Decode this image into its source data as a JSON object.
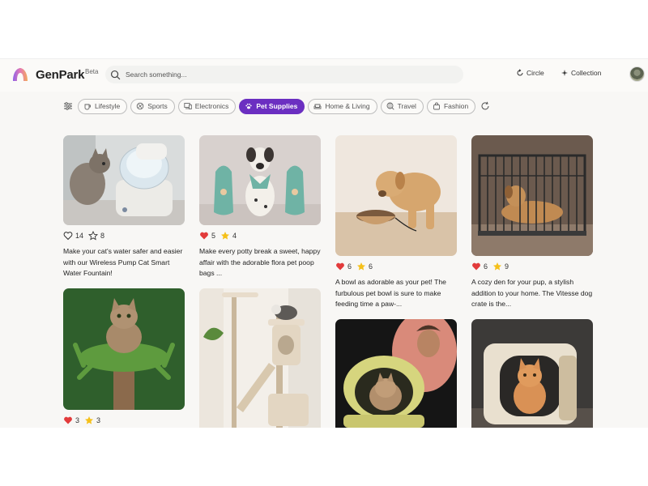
{
  "header": {
    "brand": "GenPark",
    "beta": "Beta",
    "search_placeholder": "Search something...",
    "nav": [
      {
        "label": "Circle",
        "icon": "circle-refresh-icon"
      },
      {
        "label": "Collection",
        "icon": "sparkle-icon"
      }
    ],
    "accent": "#6b2fc1"
  },
  "categories": [
    {
      "label": "Lifestyle",
      "icon": "cup-icon",
      "active": false
    },
    {
      "label": "Sports",
      "icon": "ball-icon",
      "active": false
    },
    {
      "label": "Electronics",
      "icon": "devices-icon",
      "active": false
    },
    {
      "label": "Pet Supplies",
      "icon": "paw-icon",
      "active": true
    },
    {
      "label": "Home & Living",
      "icon": "sofa-icon",
      "active": false
    },
    {
      "label": "Travel",
      "icon": "globe-icon",
      "active": false
    },
    {
      "label": "Fashion",
      "icon": "bag-icon",
      "active": false
    }
  ],
  "cards": [
    {
      "likes": "14",
      "stars": "8",
      "liked": false,
      "starred": false,
      "text": "Make your cat's water safer and easier with our Wireless Pump Cat Smart Water Fountain!"
    },
    {
      "likes": "5",
      "stars": "4",
      "liked": true,
      "starred": true,
      "text": "Make every potty break a sweet, happy affair with the adorable flora pet poop bags ..."
    },
    {
      "likes": "6",
      "stars": "6",
      "liked": true,
      "starred": true,
      "text": "A bowl as adorable as your pet! The furbulous pet bowl is sure to make feeding time a paw-..."
    },
    {
      "likes": "6",
      "stars": "9",
      "liked": true,
      "starred": true,
      "text": "A cozy den for your pup, a stylish addition to your home. The Vitesse dog crate is the..."
    },
    {
      "likes": "3",
      "stars": "3",
      "liked": true,
      "starred": true,
      "text": ""
    },
    {
      "likes": "",
      "stars": "",
      "liked": false,
      "starred": false,
      "text": ""
    },
    {
      "likes": "",
      "stars": "",
      "liked": false,
      "starred": false,
      "text": ""
    },
    {
      "likes": "",
      "stars": "",
      "liked": false,
      "starred": false,
      "text": ""
    }
  ]
}
